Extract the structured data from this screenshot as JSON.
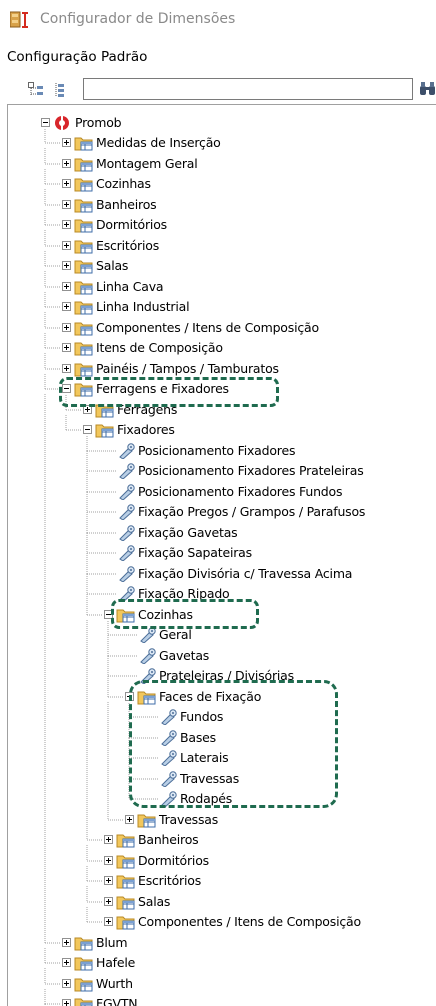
{
  "window": {
    "title": "Configurador de Dimensões"
  },
  "header": {
    "subtitle": "Configuração Padrão"
  },
  "toolbar": {
    "search_value": "",
    "search_placeholder": ""
  },
  "colors": {
    "highlight": "#1f6b4f",
    "folder": "#e8b84a",
    "window_title": "#8a8a8a"
  },
  "icons": {
    "app": "app-icon",
    "expand_all": "expand-all-icon",
    "collapse_all": "collapse-all-icon",
    "find": "binoculars-icon",
    "root": "promob-logo-icon",
    "folder": "folder-table-icon",
    "item": "wrench-tag-icon"
  },
  "tree": {
    "root": "Promob",
    "n1": "Medidas de Inserção",
    "n2": "Montagem Geral",
    "n3": "Cozinhas",
    "n4": "Banheiros",
    "n5": "Dormitórios",
    "n6": "Escritórios",
    "n7": "Salas",
    "n8": "Linha Cava",
    "n9": "Linha Industrial",
    "n10": "Componentes / Itens de Composição",
    "n11": "Itens de Composição",
    "n12": "Painéis / Tampos / Tamburatos",
    "n13": "Ferragens e Fixadores",
    "n14": "Ferragens",
    "n15": "Fixadores",
    "n16": "Posicionamento Fixadores",
    "n17": "Posicionamento Fixadores Prateleiras",
    "n18": "Posicionamento Fixadores Fundos",
    "n19": "Fixação Pregos / Grampos / Parafusos",
    "n20": "Fixação Gavetas",
    "n21": "Fixação Sapateiras",
    "n22": "Fixação Divisória c/ Travessa Acima",
    "n23": "Fixação Ripado",
    "n24": "Cozinhas",
    "n25": "Geral",
    "n26": "Gavetas",
    "n27": "Prateleiras / Divisórias",
    "n28": "Faces de Fixação",
    "n29": "Fundos",
    "n30": "Bases",
    "n31": "Laterais",
    "n32": "Travessas",
    "n33": "Rodapés",
    "n34": "Travessas",
    "n35": "Banheiros",
    "n36": "Dormitórios",
    "n37": "Escritórios",
    "n38": "Salas",
    "n39": "Componentes / Itens de Composição",
    "n40": "Blum",
    "n41": "Hafele",
    "n42": "Wurth",
    "n43": "FGVTN"
  }
}
